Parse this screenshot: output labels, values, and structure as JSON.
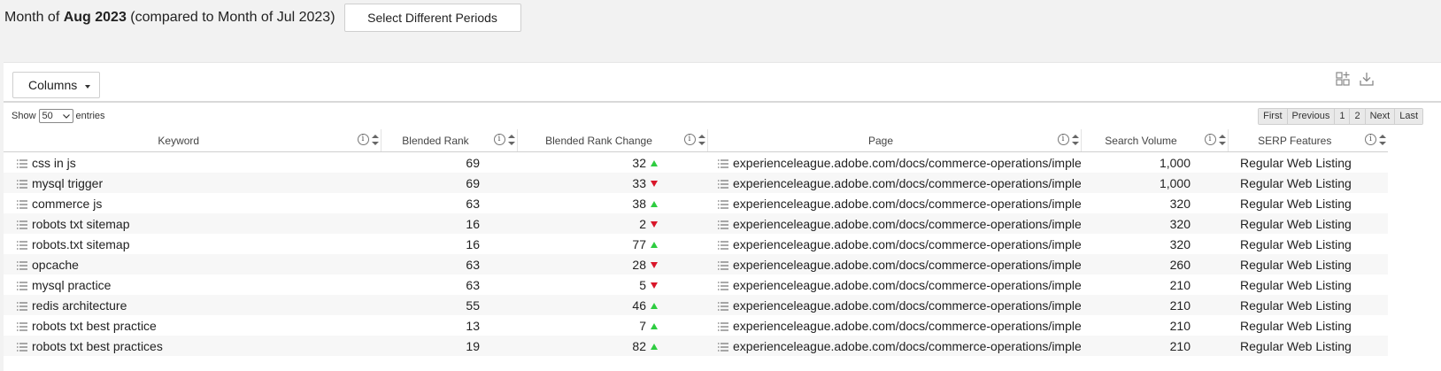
{
  "period": {
    "prefix": "Month of ",
    "current": "Aug 2023",
    "suffix": " (compared to Month of Jul 2023)",
    "select_button": "Select Different Periods"
  },
  "toolbar": {
    "columns_label": "Columns",
    "show_label": "Show",
    "entries_value": "50",
    "entries_label": "entries"
  },
  "pager": [
    "First",
    "Previous",
    "1",
    "2",
    "Next",
    "Last"
  ],
  "columns": [
    "Keyword",
    "Blended Rank",
    "Blended Rank Change",
    "Page",
    "Search Volume",
    "SERP Features"
  ],
  "rows": [
    {
      "keyword": "css in js",
      "rank": "69",
      "change": "32",
      "dir": "up",
      "page": "experienceleague.adobe.com/docs/commerce-operations/imple",
      "volume": "1,000",
      "serp": "Regular Web Listing"
    },
    {
      "keyword": "mysql trigger",
      "rank": "69",
      "change": "33",
      "dir": "down",
      "page": "experienceleague.adobe.com/docs/commerce-operations/imple",
      "volume": "1,000",
      "serp": "Regular Web Listing"
    },
    {
      "keyword": "commerce js",
      "rank": "63",
      "change": "38",
      "dir": "up",
      "page": "experienceleague.adobe.com/docs/commerce-operations/imple",
      "volume": "320",
      "serp": "Regular Web Listing"
    },
    {
      "keyword": "robots txt sitemap",
      "rank": "16",
      "change": "2",
      "dir": "down",
      "page": "experienceleague.adobe.com/docs/commerce-operations/imple",
      "volume": "320",
      "serp": "Regular Web Listing"
    },
    {
      "keyword": "robots.txt sitemap",
      "rank": "16",
      "change": "77",
      "dir": "up",
      "page": "experienceleague.adobe.com/docs/commerce-operations/imple",
      "volume": "320",
      "serp": "Regular Web Listing"
    },
    {
      "keyword": "opcache",
      "rank": "63",
      "change": "28",
      "dir": "down",
      "page": "experienceleague.adobe.com/docs/commerce-operations/imple",
      "volume": "260",
      "serp": "Regular Web Listing"
    },
    {
      "keyword": "mysql practice",
      "rank": "63",
      "change": "5",
      "dir": "down",
      "page": "experienceleague.adobe.com/docs/commerce-operations/imple",
      "volume": "210",
      "serp": "Regular Web Listing"
    },
    {
      "keyword": "redis architecture",
      "rank": "55",
      "change": "46",
      "dir": "up",
      "page": "experienceleague.adobe.com/docs/commerce-operations/imple",
      "volume": "210",
      "serp": "Regular Web Listing"
    },
    {
      "keyword": "robots txt best practice",
      "rank": "13",
      "change": "7",
      "dir": "up",
      "page": "experienceleague.adobe.com/docs/commerce-operations/imple",
      "volume": "210",
      "serp": "Regular Web Listing"
    },
    {
      "keyword": "robots txt best practices",
      "rank": "19",
      "change": "82",
      "dir": "up",
      "page": "experienceleague.adobe.com/docs/commerce-operations/imple",
      "volume": "210",
      "serp": "Regular Web Listing"
    }
  ],
  "colors": {
    "up": "#2ecc40",
    "down": "#d9162a"
  },
  "icons": {
    "row": "list-icon",
    "header_info": "info-icon",
    "header_sort": "sort-icon",
    "grid_add": "grid-add-icon",
    "download": "download-icon"
  }
}
